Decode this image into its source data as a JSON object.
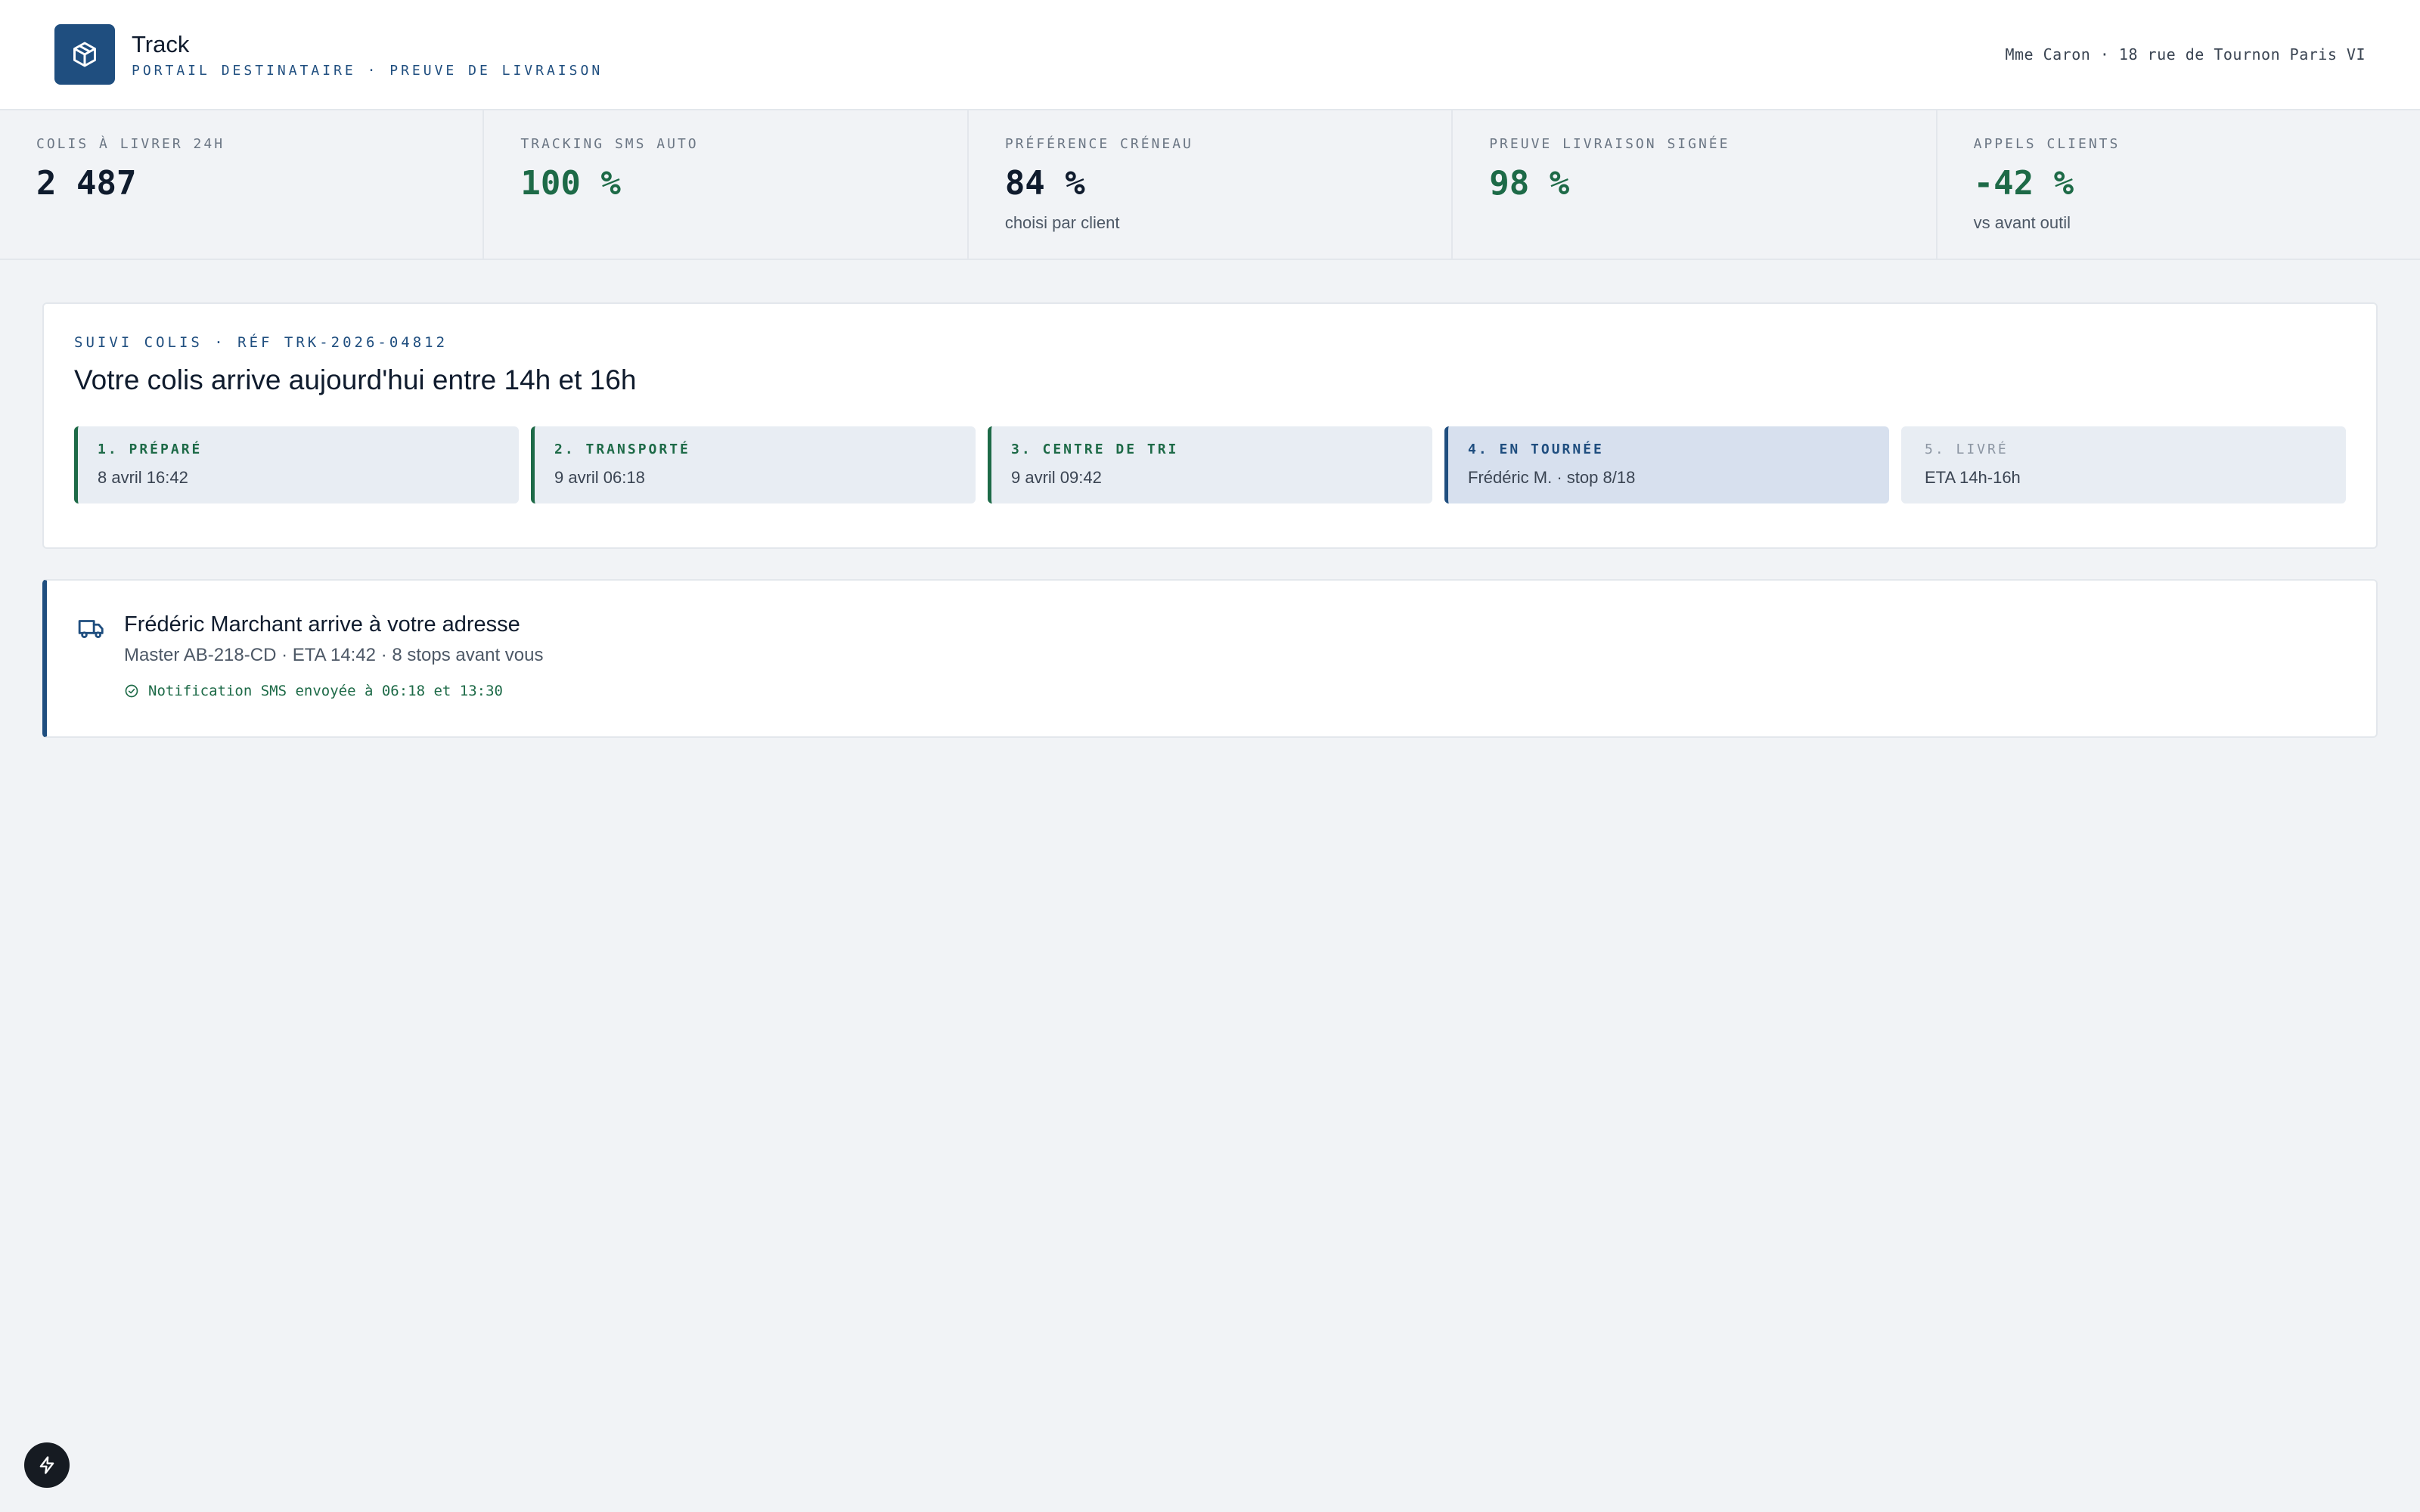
{
  "header": {
    "app_name": "Track",
    "subtitle": "PORTAIL DESTINATAIRE · PREUVE DE LIVRAISON",
    "user": "Mme Caron · 18 rue de Tournon Paris VI",
    "logo_icon": "package-icon"
  },
  "kpis": [
    {
      "label": "COLIS À LIVRER 24H",
      "value": "2 487",
      "note": ""
    },
    {
      "label": "TRACKING SMS AUTO",
      "value": "100 %",
      "note": ""
    },
    {
      "label": "PRÉFÉRENCE CRÉNEAU",
      "value": "84 %",
      "note": "choisi par client"
    },
    {
      "label": "PREUVE LIVRAISON SIGNÉE",
      "value": "98 %",
      "note": ""
    },
    {
      "label": "APPELS CLIENTS",
      "value": "-42 %",
      "note": "vs avant outil"
    }
  ],
  "tracking": {
    "ref": "SUIVI COLIS · RÉF TRK-2026-04812",
    "title": "Votre colis arrive aujourd'hui entre 14h et 16h",
    "steps": [
      {
        "label": "1. PRÉPARÉ",
        "detail": "8 avril 16:42",
        "state": "done"
      },
      {
        "label": "2. TRANSPORTÉ",
        "detail": "9 avril 06:18",
        "state": "done"
      },
      {
        "label": "3. CENTRE DE TRI",
        "detail": "9 avril 09:42",
        "state": "done"
      },
      {
        "label": "4. EN TOURNÉE",
        "detail": "Frédéric M. · stop 8/18",
        "state": "active"
      },
      {
        "label": "5. LIVRÉ",
        "detail": "ETA 14h-16h",
        "state": "pending"
      }
    ]
  },
  "driver": {
    "title": "Frédéric Marchant arrive à votre adresse",
    "meta": "Master AB-218-CD · ETA 14:42 · 8 stops avant vous",
    "sms": "Notification SMS envoyée à 06:18 et 13:30",
    "icon": "truck-icon",
    "sms_icon": "check-circle-icon"
  },
  "colors": {
    "brand": "#1f4e7f",
    "success": "#1d6a47",
    "background": "#f1f3f6"
  }
}
